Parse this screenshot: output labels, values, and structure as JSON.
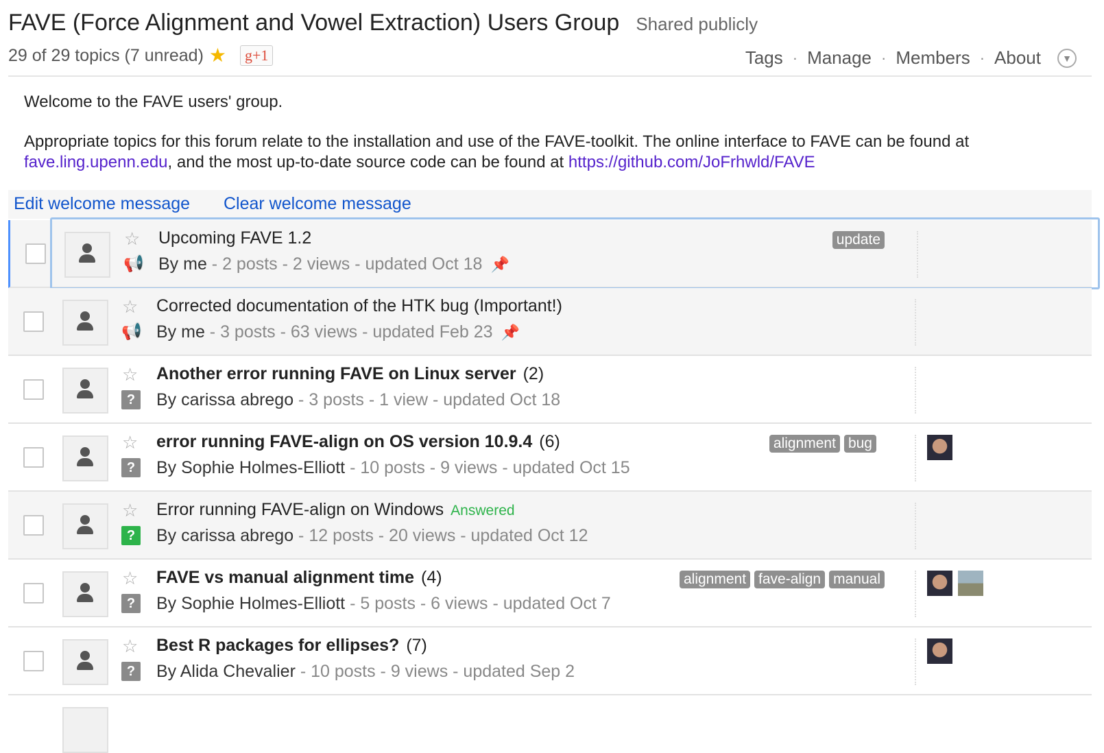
{
  "header": {
    "title": "FAVE (Force Alignment and Vowel Extraction) Users Group",
    "shared": "Shared publicly",
    "topic_count": "29 of 29 topics (7 unread)",
    "gplus": "g+1",
    "nav": {
      "tags": "Tags",
      "manage": "Manage",
      "members": "Members",
      "about": "About",
      "dot": "·"
    }
  },
  "welcome": {
    "line1": "Welcome to the FAVE users' group.",
    "line2_a": "Appropriate topics for this forum relate to the installation and use of the FAVE-toolkit. The online interface to FAVE can be found at ",
    "link1": "fave.ling.upenn.edu",
    "line2_b": ", and the most up-to-date source code can be found at ",
    "link2": "https://github.com/JoFrhwld/FAVE",
    "edit": "Edit welcome message",
    "clear": "Clear welcome message"
  },
  "topics": [
    {
      "title": "Upcoming FAVE 1.2",
      "count": "",
      "answered": "",
      "author": "me",
      "meta": " - 2 posts - 2 views - updated Oct 18",
      "tags": [
        "update"
      ]
    },
    {
      "title": "Corrected documentation of the HTK bug (Important!)",
      "count": "",
      "answered": "",
      "author": "me",
      "meta": " - 3 posts - 63 views - updated Feb 23",
      "tags": []
    },
    {
      "title": "Another error running FAVE on Linux server",
      "count": "(2)",
      "answered": "",
      "author": "carissa abrego",
      "meta": " - 3 posts - 1 view - updated Oct 18",
      "tags": []
    },
    {
      "title": "error running FAVE-align on OS version 10.9.4",
      "count": "(6)",
      "answered": "",
      "author": "Sophie Holmes-Elliott",
      "meta": " - 10 posts - 9 views - updated Oct 15",
      "tags": [
        "alignment",
        "bug"
      ]
    },
    {
      "title": "Error running FAVE-align on Windows",
      "count": "",
      "answered": "Answered",
      "author": "carissa abrego",
      "meta": " - 12 posts - 20 views - updated Oct 12",
      "tags": []
    },
    {
      "title": "FAVE vs manual alignment time",
      "count": "(4)",
      "answered": "",
      "author": "Sophie Holmes-Elliott",
      "meta": " - 5 posts - 6 views - updated Oct 7",
      "tags": [
        "alignment",
        "fave-align",
        "manual"
      ]
    },
    {
      "title": "Best R packages for ellipses?",
      "count": "(7)",
      "answered": "",
      "author": "Alida Chevalier",
      "meta": " - 10 posts - 9 views - updated Sep 2",
      "tags": []
    }
  ],
  "by_prefix": "By ",
  "icons": {
    "star": "star-icon",
    "pin": "pin-icon",
    "megaphone": "megaphone-icon",
    "question": "question-icon",
    "person": "person-icon"
  },
  "colors": {
    "link": "#1155cc",
    "visited_link": "#5522cc",
    "answered": "#2db34a",
    "tag_bg": "#8f8f8f",
    "focus": "#9ec3ec",
    "accent_border": "#4d90fe"
  }
}
